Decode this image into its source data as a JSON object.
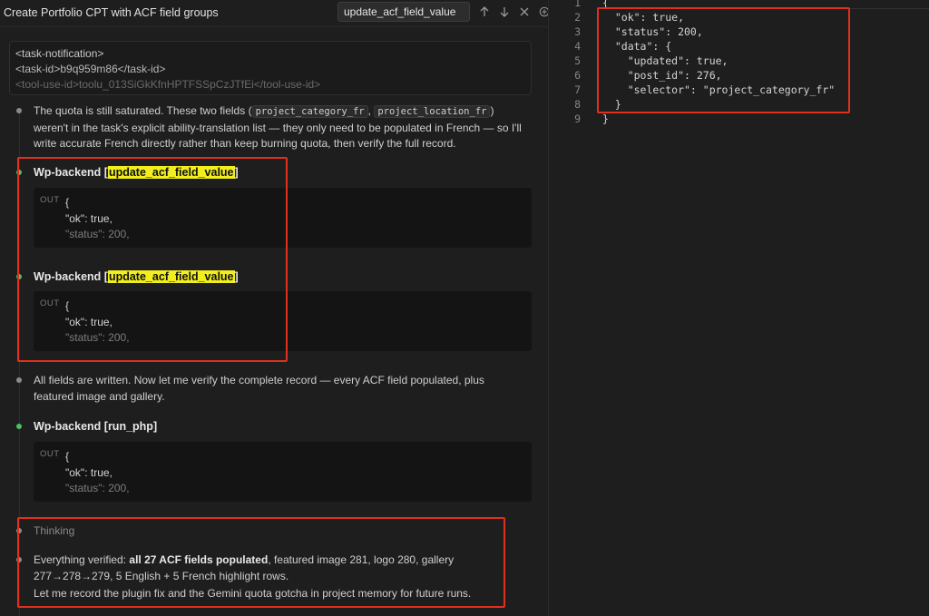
{
  "header": {
    "title": "Create Portfolio CPT with ACF field groups",
    "find_value": "update_acf_field_value"
  },
  "task_notification": {
    "line1": "<task-notification>",
    "line2": "<task-id>b9q959m86</task-id>",
    "line3": "<tool-use-id>toolu_013SiGkKfnHPTFSSpCzJTfEi</tool-use-id>"
  },
  "para1": {
    "a": "The quota is still saturated. These two fields (",
    "code1": "project_category_fr",
    "sep": ",",
    "code2": "project_location_fr",
    "b": ")",
    "c": "weren't in the task's explicit ability-translation list — they only need to be populated in French — so I'll",
    "d": "write accurate French directly rather than keep burning quota, then verify the full record."
  },
  "tools": [
    {
      "prefix": "Wp-backend [",
      "name": "update_acf_field_value",
      "suffix": "]",
      "out_label": "OUT",
      "out": [
        "{",
        "\"ok\": true,",
        "\"status\": 200,"
      ]
    },
    {
      "prefix": "Wp-backend [",
      "name": "update_acf_field_value",
      "suffix": "]",
      "out_label": "OUT",
      "out": [
        "{",
        "\"ok\": true,",
        "\"status\": 200,"
      ]
    },
    {
      "title": "Wp-backend [run_php]",
      "out_label": "OUT",
      "out": [
        "{",
        "\"ok\": true,",
        "\"status\": 200,"
      ]
    }
  ],
  "para2": {
    "a": "All fields are written. Now let me verify the complete record — every ACF field populated, plus",
    "b": "featured image and gallery."
  },
  "thinking_label": "Thinking",
  "para3": {
    "a": "Everything verified: ",
    "bold": "all 27 ACF fields populated",
    "b": ", featured image 281, logo 280, gallery",
    "c": "277→278→279, 5 English + 5 French highlight rows.",
    "d": "Let me record the plugin fix and the Gemini quota gotcha in project memory for future runs."
  },
  "editor": {
    "lines": [
      {
        "n": "1",
        "t": "{"
      },
      {
        "n": "2",
        "t": "  \"ok\": true,"
      },
      {
        "n": "3",
        "t": "  \"status\": 200,"
      },
      {
        "n": "4",
        "t": "  \"data\": {"
      },
      {
        "n": "5",
        "t": "    \"updated\": true,"
      },
      {
        "n": "6",
        "t": "    \"post_id\": 276,"
      },
      {
        "n": "7",
        "t": "    \"selector\": \"project_category_fr\""
      },
      {
        "n": "8",
        "t": "  }"
      },
      {
        "n": "9",
        "t": "}"
      }
    ]
  },
  "colors": {
    "accent_highlight": "#f2ee1e",
    "annotation_red": "#e0301e",
    "success_dot": "#4cbe63",
    "background": "#1e1e1e"
  }
}
